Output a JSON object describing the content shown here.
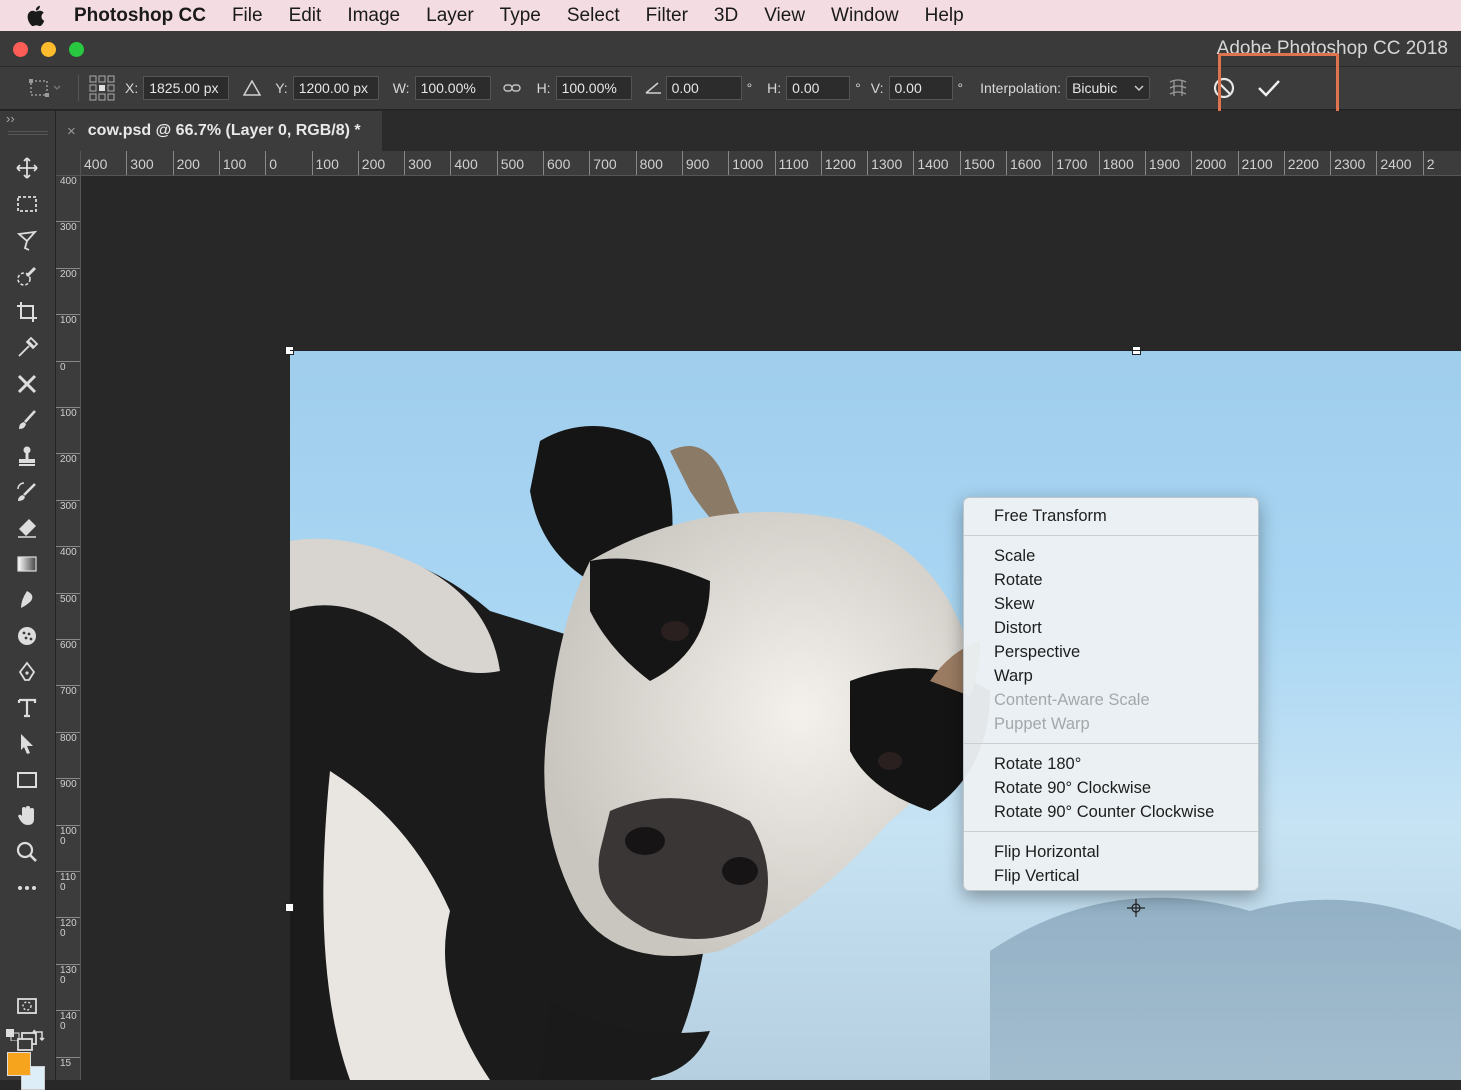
{
  "menubar": {
    "app_name": "Photoshop CC",
    "items": [
      "File",
      "Edit",
      "Image",
      "Layer",
      "Type",
      "Select",
      "Filter",
      "3D",
      "View",
      "Window",
      "Help"
    ]
  },
  "window": {
    "title": "Adobe Photoshop CC 2018"
  },
  "options": {
    "x_label": "X:",
    "x_value": "1825.00 px",
    "y_label": "Y:",
    "y_value": "1200.00 px",
    "w_label": "W:",
    "w_value": "100.00%",
    "h_label": "H:",
    "h_value": "100.00%",
    "angle_value": "0.00",
    "degree_symbol": "°",
    "hskew_label": "H:",
    "hskew_value": "0.00",
    "vskew_label": "V:",
    "vskew_value": "0.00",
    "interpolation_label": "Interpolation:",
    "interpolation_value": "Bicubic"
  },
  "document": {
    "tab_title": "cow.psd @ 66.7% (Layer 0, RGB/8) *",
    "close_glyph": "×"
  },
  "ruler": {
    "top_ticks": [
      "400",
      "300",
      "200",
      "100",
      "0",
      "100",
      "200",
      "300",
      "400",
      "500",
      "600",
      "700",
      "800",
      "900",
      "1000",
      "1100",
      "1200",
      "1300",
      "1400",
      "1500",
      "1600",
      "1700",
      "1800",
      "1900",
      "2000",
      "2100",
      "2200",
      "2300",
      "2400",
      "2"
    ],
    "left_ticks": [
      "400",
      "300",
      "200",
      "100",
      "0",
      "100",
      "200",
      "300",
      "400",
      "500",
      "600",
      "700",
      "800",
      "900",
      "1000",
      "1100",
      "1200",
      "1300",
      "1400",
      "15"
    ]
  },
  "context_menu": {
    "groups": [
      [
        {
          "label": "Free Transform",
          "enabled": true
        }
      ],
      [
        {
          "label": "Scale",
          "enabled": true
        },
        {
          "label": "Rotate",
          "enabled": true
        },
        {
          "label": "Skew",
          "enabled": true
        },
        {
          "label": "Distort",
          "enabled": true
        },
        {
          "label": "Perspective",
          "enabled": true
        },
        {
          "label": "Warp",
          "enabled": true
        },
        {
          "label": "Content-Aware Scale",
          "enabled": false
        },
        {
          "label": "Puppet Warp",
          "enabled": false
        }
      ],
      [
        {
          "label": "Rotate 180°",
          "enabled": true
        },
        {
          "label": "Rotate 90° Clockwise",
          "enabled": true
        },
        {
          "label": "Rotate 90° Counter Clockwise",
          "enabled": true
        }
      ],
      [
        {
          "label": "Flip Horizontal",
          "enabled": true
        },
        {
          "label": "Flip Vertical",
          "enabled": true
        }
      ]
    ]
  },
  "colors": {
    "foreground": "#f6a41d",
    "background": "#ddeef8",
    "highlight": "#e0734f"
  }
}
